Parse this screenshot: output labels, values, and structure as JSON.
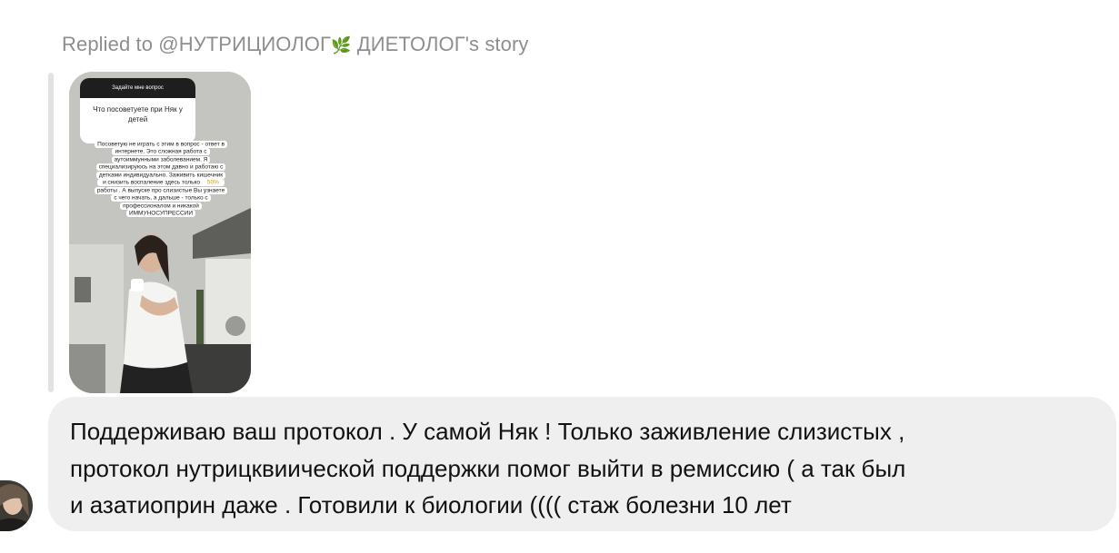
{
  "header": {
    "replied_prefix": "Replied to @НУТРИЦИОЛОГ",
    "leaf_emoji": "🌿",
    "replied_suffix": " ДИЕТОЛОГ's story"
  },
  "story": {
    "question_title": "Задайте мне вопрос",
    "question_text": "Что посоветуете при Няк у детей",
    "answer_lines": [
      "Посоветую не играть с этим в вопрос - ответ в",
      "интернете. Это сложная работа с",
      "аутоиммунными заболеванием. Я",
      "специализируюсь на этом давно и работаю с",
      "детками индивидуально. Заживить кишечник",
      "и снизить воспаление здесь только",
      "работы . А выпуске про слизистые Вы узнаете",
      "с чего начать, а дальше - только с",
      "профессионалом и никакой",
      "ИММУНОСУПРЕССИИ"
    ],
    "answer_highlight": "50%"
  },
  "message": {
    "lines": [
      "Поддерживаю ваш протокол . У самой Няк ! Только заживление слизистых ,",
      "протокол нутрицквиической поддержки помог выйти в ремиссию ( а так был",
      "и азатиоприн даже . Готовили к биологии ((((  стаж болезни 10 лет"
    ]
  },
  "icons": {
    "avatar": "avatar-icon",
    "leaf": "leaf-icon"
  }
}
